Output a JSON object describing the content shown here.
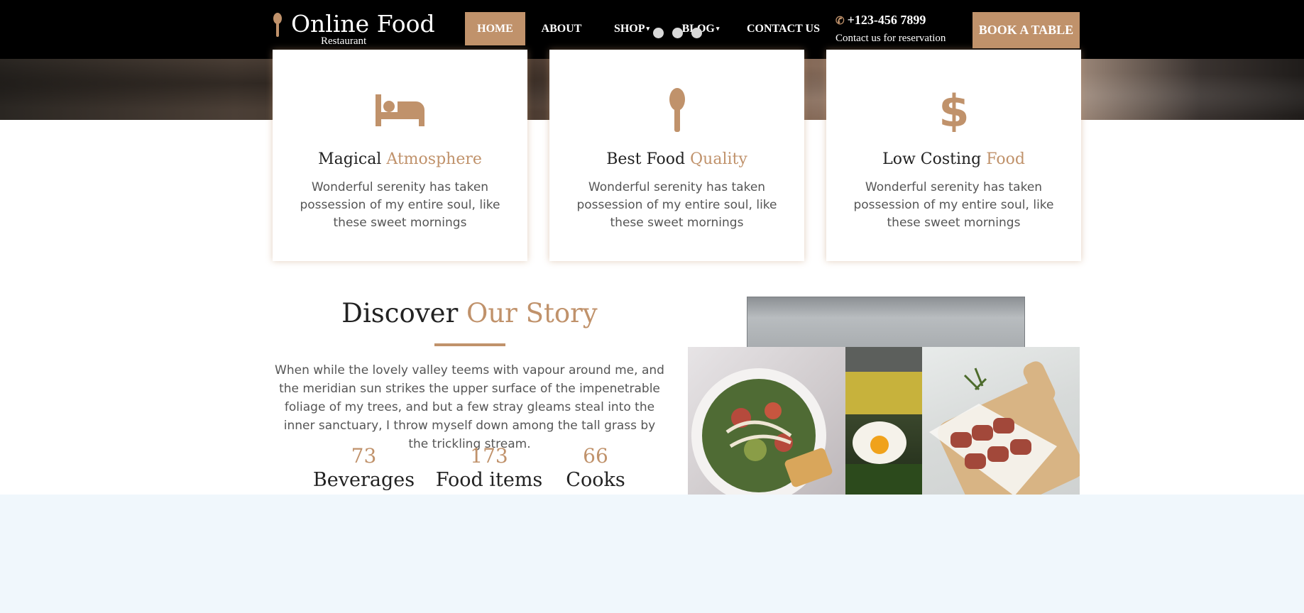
{
  "colors": {
    "accent": "#c0926b",
    "header_bg": "#000000",
    "text_dark": "#222222",
    "text_muted": "#555555"
  },
  "brand": {
    "title": "Online Food",
    "subtitle": "Restaurant",
    "icon": "spoon-icon"
  },
  "nav": {
    "items": [
      {
        "label": "HOME",
        "active": true
      },
      {
        "label": "ABOUT",
        "active": false
      },
      {
        "label": "SHOP",
        "active": false,
        "dropdown": true
      },
      {
        "label": "BLOG",
        "active": false,
        "dropdown": true
      },
      {
        "label": "CONTACT US",
        "active": false
      }
    ],
    "caret": "▾"
  },
  "contact": {
    "phone": "+123-456 7899",
    "phone_icon": "phone-icon",
    "note": "Contact us for reservation"
  },
  "book_button": {
    "label": "BOOK A TABLE"
  },
  "features": [
    {
      "icon": "bed-icon",
      "title": "Magical ",
      "title_highlight": "Atmosphere",
      "text": "Wonderful serenity has taken possession of my entire soul, like these sweet mornings"
    },
    {
      "icon": "spoon-icon",
      "title": "Best Food ",
      "title_highlight": "Quality",
      "text": "Wonderful serenity has taken possession of my entire soul, like these sweet mornings"
    },
    {
      "icon": "dollar-icon",
      "title": "Low Costing ",
      "title_highlight": "Food",
      "text": "Wonderful serenity has taken possession of my entire soul, like these sweet mornings"
    }
  ],
  "story": {
    "title": "Discover ",
    "title_highlight": "Our Story",
    "text": "When while the lovely valley teems with vapour around me, and the meridian sun strikes the upper surface of the impenetrable foliage of my trees, and but a few stray gleams steal into the inner sanctuary, I throw myself down among the tall grass by the trickling stream.",
    "stats": [
      {
        "value": "73",
        "label": "Beverages"
      },
      {
        "value": "173",
        "label": "Food items"
      },
      {
        "value": "66",
        "label": "Cooks"
      }
    ]
  }
}
